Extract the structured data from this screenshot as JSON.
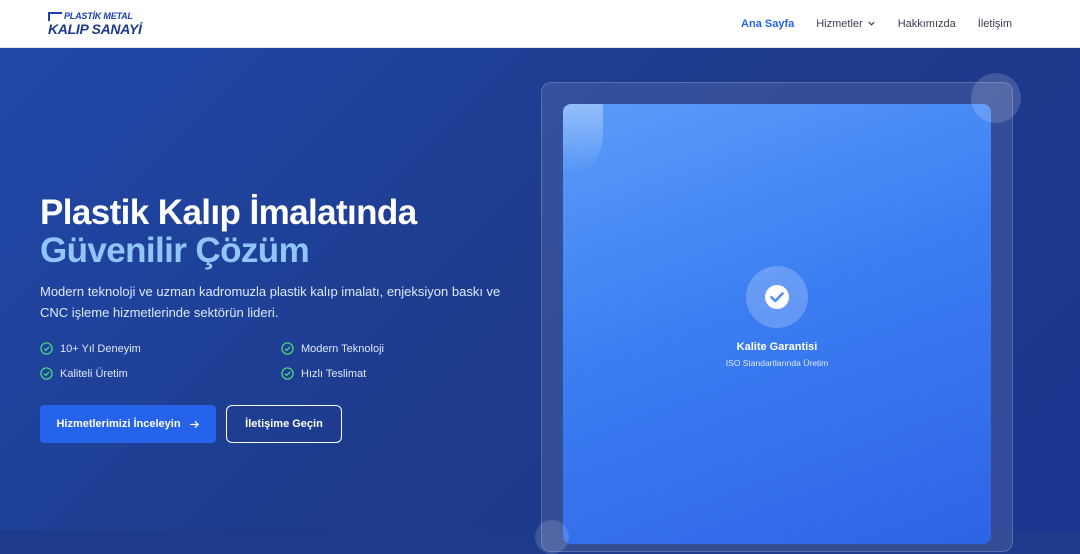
{
  "header": {
    "logo": {
      "line1": "PLASTİK METAL",
      "line2": "KALIP SANAYİ"
    },
    "nav": [
      {
        "label": "Ana Sayfa",
        "active": true
      },
      {
        "label": "Hizmetler",
        "has_dropdown": true
      },
      {
        "label": "Hakkımızda"
      },
      {
        "label": "İletişim"
      }
    ]
  },
  "hero": {
    "title_line1": "Plastik Kalıp İmalatında",
    "title_line2": "Güvenilir Çözüm",
    "description": "Modern teknoloji ve uzman kadromuzla plastik kalıp imalatı, enjeksiyon baskı ve CNC işleme hizmetlerinde sektörün lideri.",
    "features": [
      "10+ Yıl Deneyim",
      "Modern Teknoloji",
      "Kaliteli Üretim",
      "Hızlı Teslimat"
    ],
    "primary_button": "Hizmetlerimizi İnceleyin",
    "secondary_button": "İletişime Geçin"
  },
  "quality_card": {
    "title": "Kalite Garantisi",
    "subtitle": "ISO Standartlarında Üretim",
    "icon": "check-circle-icon"
  },
  "colors": {
    "accent": "#2563eb",
    "hero_bg": "#1e3a8a",
    "title_accent": "#93c5fd",
    "check": "#4ade80"
  }
}
